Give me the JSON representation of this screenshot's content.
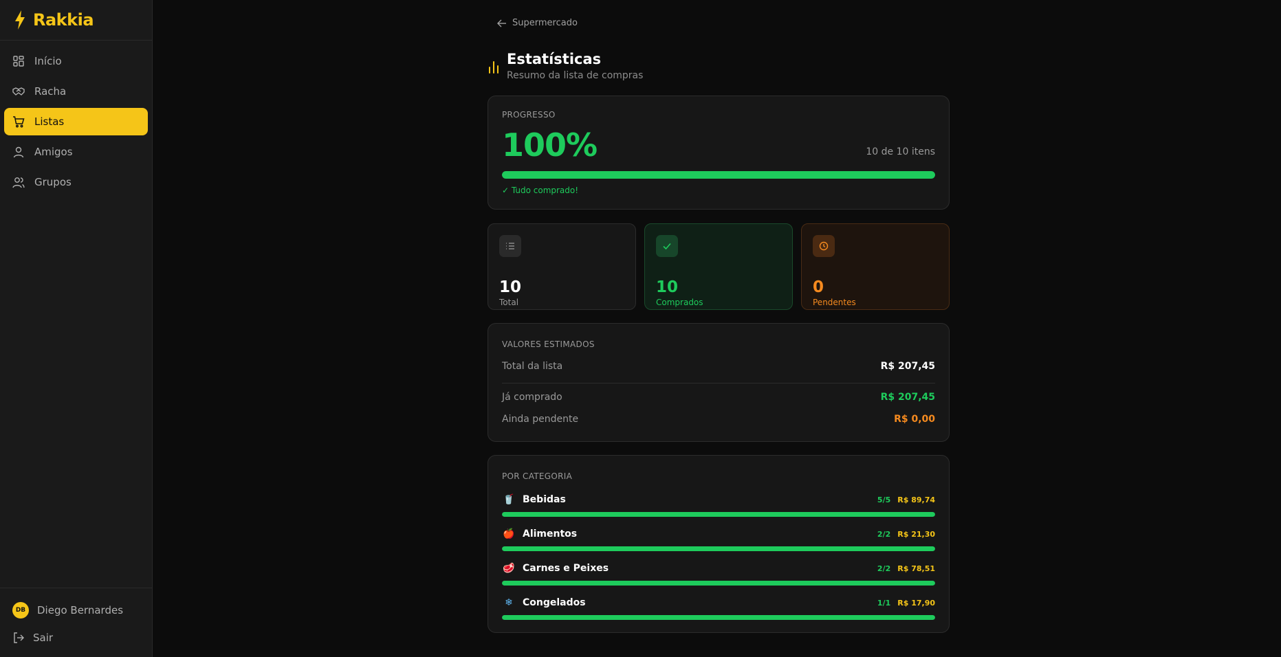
{
  "app": {
    "name": "Rakkia",
    "accent": "#f5c518"
  },
  "sidebar": {
    "items": [
      {
        "label": "Início",
        "icon": "dashboard-icon",
        "active": false
      },
      {
        "label": "Racha",
        "icon": "handshake-icon",
        "active": false
      },
      {
        "label": "Listas",
        "icon": "cart-icon",
        "active": true
      },
      {
        "label": "Amigos",
        "icon": "user-icon",
        "active": false
      },
      {
        "label": "Grupos",
        "icon": "users-icon",
        "active": false
      }
    ],
    "user": {
      "initials": "DB",
      "name": "Diego Bernardes"
    },
    "logout_label": "Sair"
  },
  "main": {
    "back_label": "Supermercado",
    "title": "Estatísticas",
    "subtitle": "Resumo da lista de compras",
    "progress": {
      "label": "PROGRESSO",
      "percent_text": "100%",
      "fraction": 1.0,
      "count_text": "10 de 10 itens",
      "status_text": "✓ Tudo comprado!"
    },
    "stats": {
      "total": {
        "value": "10",
        "label": "Total"
      },
      "bought": {
        "value": "10",
        "label": "Comprados"
      },
      "pending": {
        "value": "0",
        "label": "Pendentes"
      }
    },
    "values": {
      "label": "VALORES ESTIMADOS",
      "total_label": "Total da lista",
      "total_value": "R$ 207,45",
      "bought_label": "Já comprado",
      "bought_value": "R$ 207,45",
      "pending_label": "Ainda pendente",
      "pending_value": "R$ 0,00"
    },
    "categories": {
      "label": "POR CATEGORIA",
      "items": [
        {
          "emoji": "🥤",
          "name": "Bebidas",
          "count": "5/5",
          "price": "R$ 89,74",
          "fraction": 1.0
        },
        {
          "emoji": "🍎",
          "name": "Alimentos",
          "count": "2/2",
          "price": "R$ 21,30",
          "fraction": 1.0
        },
        {
          "emoji": "🥩",
          "name": "Carnes e Peixes",
          "count": "2/2",
          "price": "R$ 78,51",
          "fraction": 1.0
        },
        {
          "emoji": "❄",
          "name": "Congelados",
          "count": "1/1",
          "price": "R$ 17,90",
          "fraction": 1.0
        }
      ]
    }
  },
  "colors": {
    "green": "#1ecb5c",
    "orange": "#f58a1f",
    "yellow": "#f5c518"
  }
}
